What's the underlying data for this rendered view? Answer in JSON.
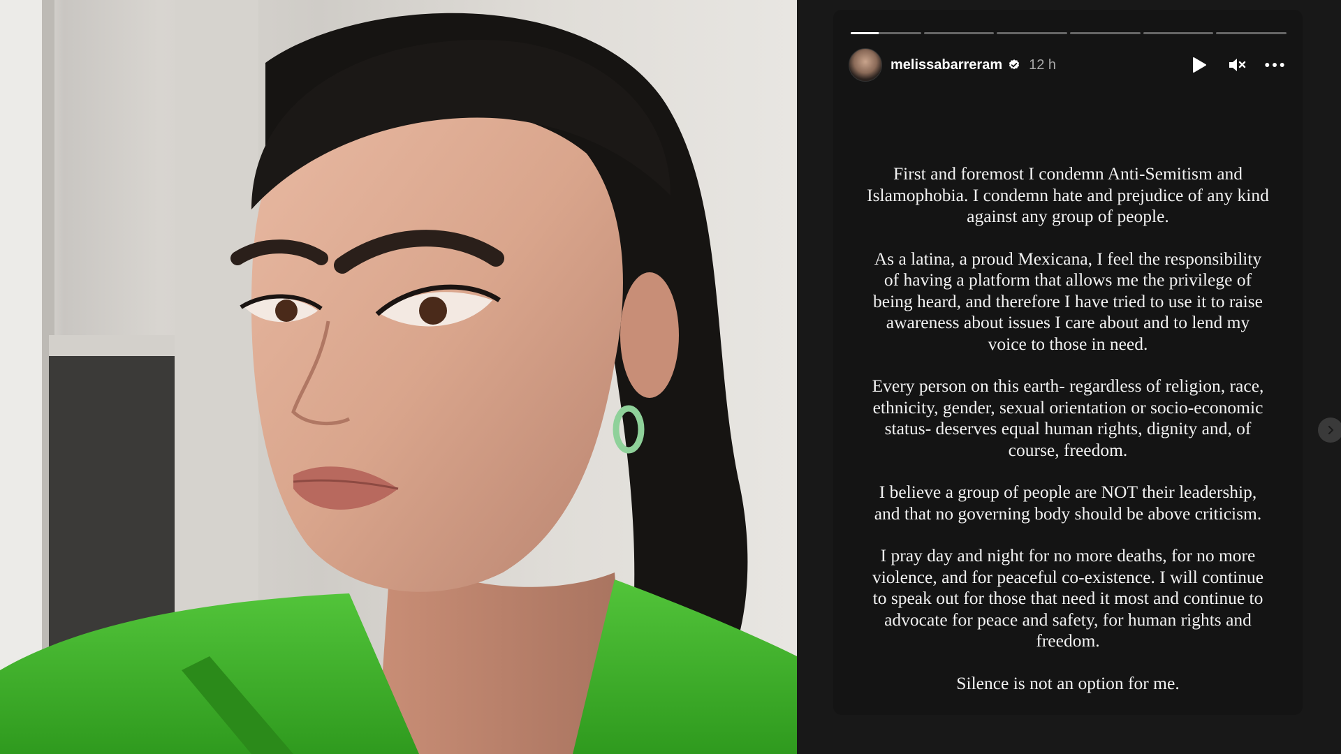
{
  "story": {
    "username": "melissabarreram",
    "time_ago": "12 h",
    "progress_segments": 6,
    "active_segment": 1,
    "active_segment_progress": 0.4,
    "icons": {
      "verified": "verified-badge-icon",
      "play": "play-icon",
      "mute": "mute-icon",
      "more": "more-options-icon",
      "next": "chevron-right-icon"
    },
    "paragraphs": [
      "First and foremost I condemn Anti-Semitism and Islamophobia. I condemn hate and prejudice of any kind against any group of people.",
      "As a latina, a proud Mexicana, I feel the responsibility of having a platform that allows me the privilege of being heard, and therefore I have tried to use it to raise awareness about issues I care about and to lend my voice to those in need.",
      "Every person on this earth- regardless of religion, race, ethnicity, gender, sexual orientation or socio-economic status- deserves equal human rights, dignity and, of course, freedom.",
      "I believe a group of people are NOT their leadership, and that no governing body should be above criticism.",
      "I pray day and night for no more deaths, for no more violence, and for peaceful co-existence. I will continue to speak out for those that need it most and continue to advocate for peace and safety, for human rights and freedom.",
      "Silence is not an option for me."
    ]
  },
  "colors": {
    "panel_bg": "#181818",
    "card_bg": "#141414",
    "text": "#f2f2f2",
    "muted": "#a8a8a8",
    "blazer_green": "#3fb82a"
  }
}
